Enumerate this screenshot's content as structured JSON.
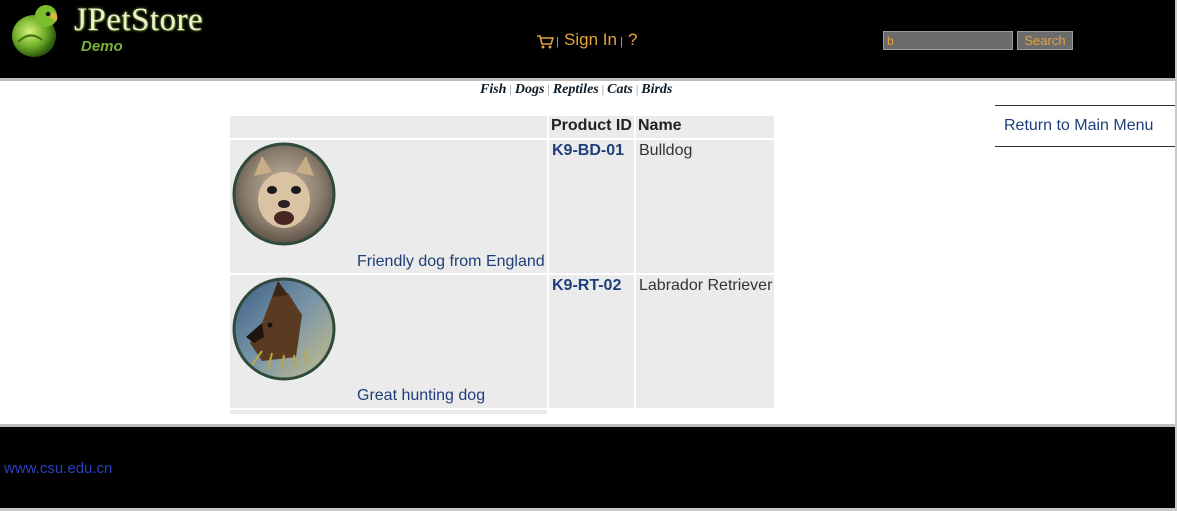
{
  "header": {
    "brand": "JPetStore",
    "subtitle": "Demo",
    "menu": {
      "sign_in": "Sign In",
      "help": "?",
      "separator": "|"
    },
    "search": {
      "value": "b",
      "button": "Search"
    }
  },
  "quicklinks": [
    "Fish",
    "Dogs",
    "Reptiles",
    "Cats",
    "Birds"
  ],
  "back_link": "Return to Main Menu",
  "table": {
    "headers": [
      "",
      "Product ID",
      "Name"
    ],
    "rows": [
      {
        "description": "Friendly dog from England",
        "product_id": "K9-BD-01",
        "name": "Bulldog",
        "image": "chihuahua-photo"
      },
      {
        "description": "Great hunting dog",
        "product_id": "K9-RT-02",
        "name": "Labrador Retriever",
        "image": "puppy-photo"
      }
    ]
  },
  "footer": {
    "link": "www.csu.edu.cn"
  },
  "colors": {
    "accent": "#e8a23a",
    "link": "#1d3f7a",
    "header_bg": "#000000",
    "cell_bg": "#ebebeb"
  }
}
